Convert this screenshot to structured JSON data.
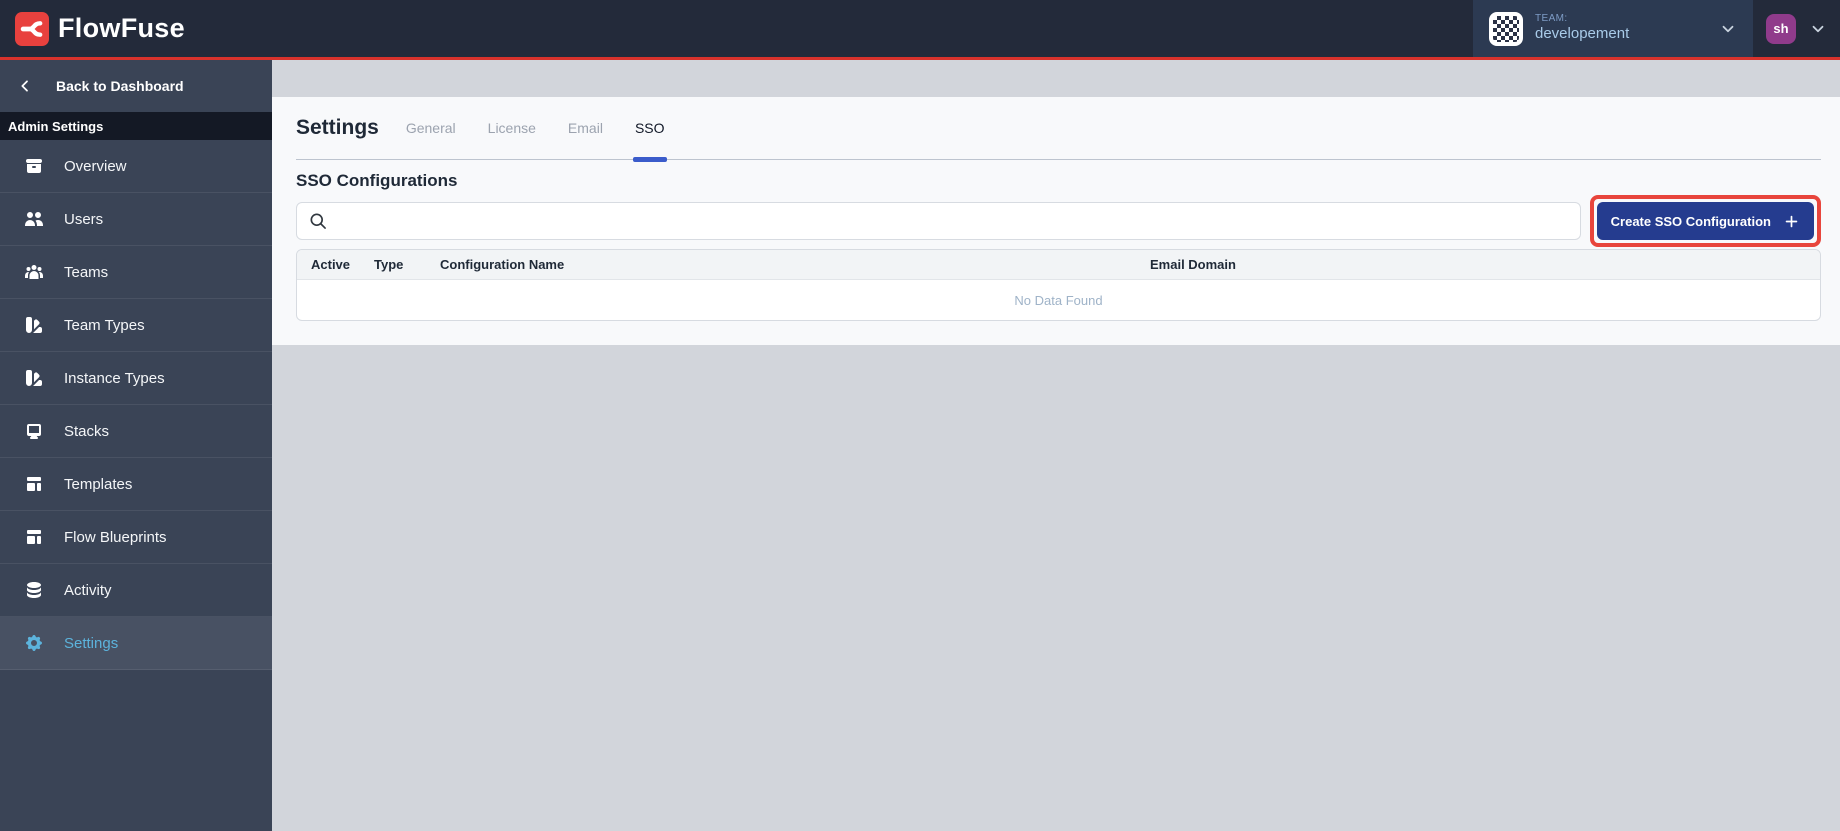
{
  "header": {
    "brand": "FlowFuse",
    "team": {
      "label": "TEAM:",
      "name": "developement"
    },
    "user": {
      "initials": "sh"
    }
  },
  "sidebar": {
    "back_label": "Back to Dashboard",
    "section_label": "Admin Settings",
    "items": [
      {
        "label": "Overview",
        "icon": "archive-icon",
        "active": false
      },
      {
        "label": "Users",
        "icon": "users-icon",
        "active": false
      },
      {
        "label": "Teams",
        "icon": "user-group-icon",
        "active": false
      },
      {
        "label": "Team Types",
        "icon": "color-swatch-icon",
        "active": false
      },
      {
        "label": "Instance Types",
        "icon": "color-swatch-icon",
        "active": false
      },
      {
        "label": "Stacks",
        "icon": "desktop-icon",
        "active": false
      },
      {
        "label": "Templates",
        "icon": "template-icon",
        "active": false
      },
      {
        "label": "Flow Blueprints",
        "icon": "template-icon",
        "active": false
      },
      {
        "label": "Activity",
        "icon": "database-icon",
        "active": false
      },
      {
        "label": "Settings",
        "icon": "cog-icon",
        "active": true
      }
    ]
  },
  "main": {
    "title": "Settings",
    "tabs": [
      {
        "label": "General",
        "active": false
      },
      {
        "label": "License",
        "active": false
      },
      {
        "label": "Email",
        "active": false
      },
      {
        "label": "SSO",
        "active": true
      }
    ],
    "section_title": "SSO Configurations",
    "search": {
      "value": ""
    },
    "create_button_label": "Create SSO Configuration",
    "table": {
      "columns": [
        "Active",
        "Type",
        "Configuration Name",
        "Email Domain"
      ],
      "rows": [],
      "empty_text": "No Data Found"
    }
  },
  "colors": {
    "navbar_bg": "#232A3A",
    "red_divider": "#D8322C",
    "brand_red": "#E8413E",
    "team_section_bg": "#2C3A52",
    "sidebar_bg": "#3A4456",
    "sidebar_section_bg": "#141925",
    "active_item_bg": "#485163",
    "active_item_text": "#5CB3DC",
    "tab_underline": "#3B5CCB",
    "create_button_bg": "#253C8F",
    "annotation_red": "#E8453C",
    "avatar_purple": "#903B8B",
    "panel_bg": "#F8F9FB",
    "page_bg": "#D2D5DB",
    "empty_text": "#9FB3C8"
  }
}
